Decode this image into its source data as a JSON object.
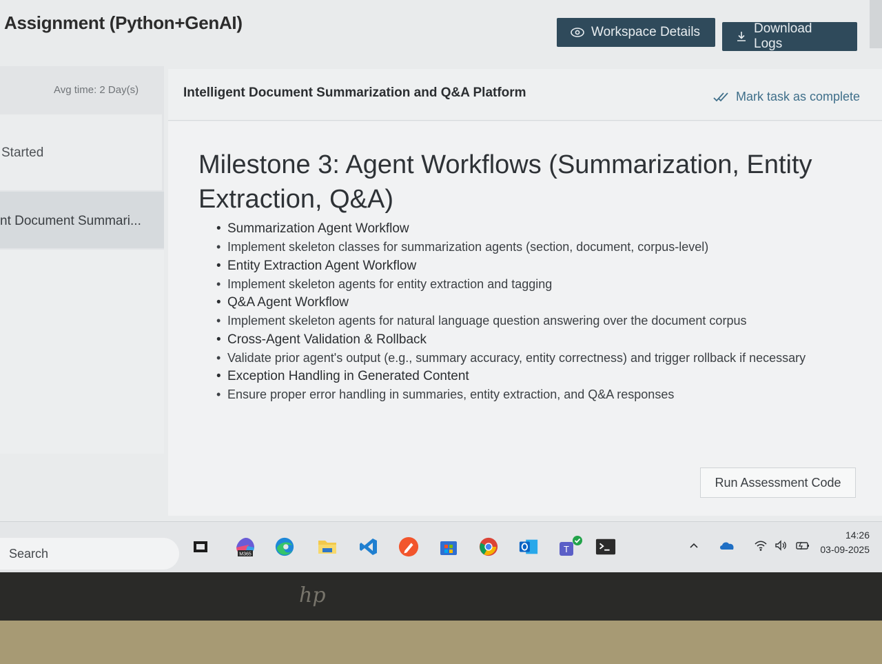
{
  "header": {
    "app_title": "Assignment (Python+GenAI)",
    "workspace_button": "Workspace Details",
    "download_button": "Download Logs"
  },
  "sidebar": {
    "avg_time": "Avg time: 2 Day(s)",
    "status_label": "Started",
    "active_item": "nt Document Summari..."
  },
  "task": {
    "title": "Intelligent Document Summarization and Q&A Platform",
    "mark_complete": "Mark task as complete"
  },
  "content": {
    "milestone_title": "Milestone 3: Agent Workflows (Summarization, Entity Extraction, Q&A)",
    "sections": [
      {
        "heading": "Summarization Agent Workflow",
        "detail": "Implement skeleton classes for summarization agents (section, document, corpus-level)"
      },
      {
        "heading": "Entity Extraction Agent Workflow",
        "detail": "Implement skeleton agents for entity extraction and tagging"
      },
      {
        "heading": "Q&A Agent Workflow",
        "detail": "Implement skeleton agents for natural language question answering over the document corpus"
      },
      {
        "heading": "Cross-Agent Validation & Rollback",
        "detail": "Validate prior agent's output (e.g., summary accuracy, entity correctness) and trigger rollback if necessary"
      },
      {
        "heading": "Exception Handling in Generated Content",
        "detail": "Ensure proper error handling in summaries, entity extraction, and Q&A responses"
      }
    ],
    "run_button": "Run Assessment Code"
  },
  "taskbar": {
    "search_label": "Search",
    "m365_badge": "M365",
    "time": "14:26",
    "date": "03-09-2025",
    "pinned_icons": [
      "task-view-icon",
      "m365-copilot-icon",
      "edge-icon",
      "file-explorer-icon",
      "vscode-icon",
      "pen-app-icon",
      "store-icon",
      "chrome-icon",
      "outlook-icon",
      "teams-icon",
      "terminal-icon"
    ]
  },
  "device": {
    "bezel_logo": "hp"
  }
}
